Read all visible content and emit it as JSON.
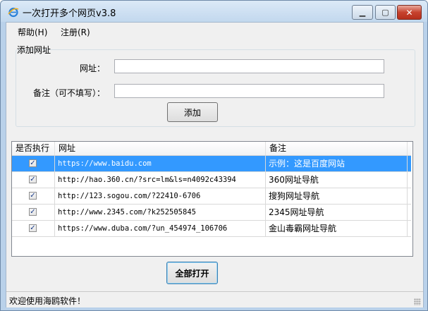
{
  "window": {
    "title": "一次打开多个网页v3.8",
    "minimize_symbol": "▁",
    "maximize_symbol": "▢",
    "close_symbol": "✕"
  },
  "menu": {
    "help": "帮助(H)",
    "register": "注册(R)"
  },
  "add_group": {
    "title": "添加网址",
    "url_label": "网址：",
    "url_value": "",
    "note_label": "备注（可不填写）：",
    "note_value": "",
    "add_button": "添加"
  },
  "table": {
    "columns": [
      "是否执行",
      "网址",
      "备注"
    ],
    "rows": [
      {
        "checked": true,
        "url": "https://www.baidu.com",
        "note": "示例：这是百度网站",
        "selected": true
      },
      {
        "checked": true,
        "url": "http://hao.360.cn/?src=lm&ls=n4092c43394",
        "note": "360网址导航",
        "selected": false
      },
      {
        "checked": true,
        "url": "http://123.sogou.com/?22410-6706",
        "note": "搜狗网址导航",
        "selected": false
      },
      {
        "checked": true,
        "url": "http://www.2345.com/?k252505845",
        "note": "2345网址导航",
        "selected": false
      },
      {
        "checked": true,
        "url": "https://www.duba.com/?un_454974_106706",
        "note": "金山毒霸网址导航",
        "selected": false
      }
    ],
    "checkmark": "✓"
  },
  "open_all_button": "全部打开",
  "status": {
    "text": "欢迎使用海鸥软件！"
  },
  "colors": {
    "selection": "#3399ff",
    "window_frame": "#b9d1ea",
    "close_button": "#c7422e"
  }
}
